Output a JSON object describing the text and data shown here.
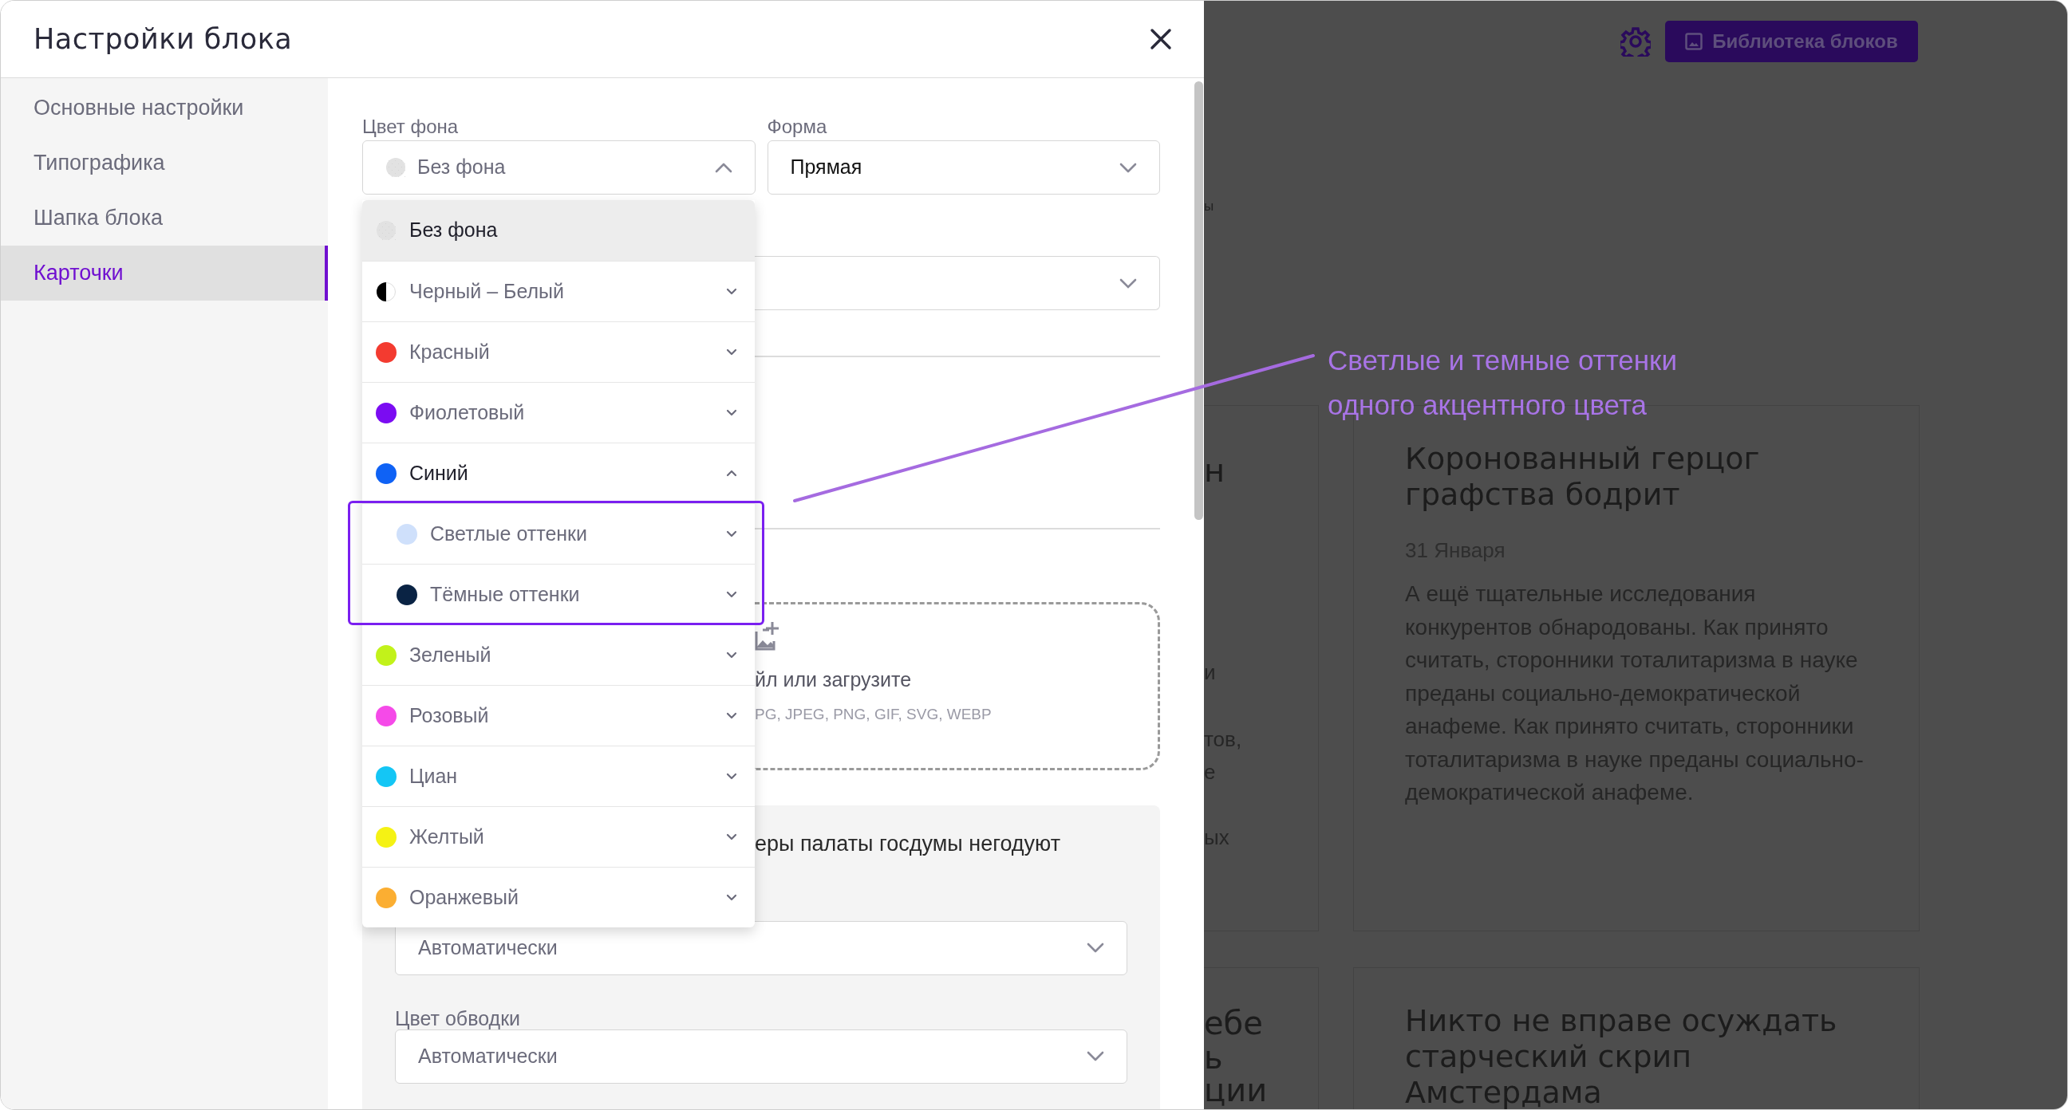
{
  "dialog": {
    "title": "Настройки блока"
  },
  "sidebar": {
    "items": [
      {
        "label": "Основные настройки",
        "selected": false
      },
      {
        "label": "Типографика",
        "selected": false
      },
      {
        "label": "Шапка блока",
        "selected": false
      },
      {
        "label": "Карточки",
        "selected": true
      }
    ]
  },
  "fields": [
    {
      "label": "Цвет фона",
      "value": "Без фона",
      "kind": "swatch",
      "expanded": true
    },
    {
      "label": "Форма",
      "value": "Прямая",
      "kind": "plain",
      "expanded": false
    }
  ],
  "color_menu": {
    "options": [
      {
        "label": "Без фона",
        "kind": "none",
        "selected": true
      },
      {
        "label": "Черный – Белый",
        "kind": "split",
        "selected": false,
        "expanded": false
      },
      {
        "label": "Красный",
        "kind": "solid",
        "color": "#f33b30",
        "selected": false,
        "expanded": false
      },
      {
        "label": "Фиолетовый",
        "kind": "solid",
        "color": "#7b0cf2",
        "selected": false,
        "expanded": false
      },
      {
        "label": "Синий",
        "kind": "solid",
        "color": "#0f62f5",
        "selected": false,
        "expanded": true,
        "children": [
          {
            "label": "Светлые оттенки",
            "kind": "solid",
            "color": "#cfe0fb",
            "selected": false,
            "expanded": false
          },
          {
            "label": "Тёмные оттенки",
            "kind": "solid",
            "color": "#0a2344",
            "selected": false,
            "expanded": false
          }
        ]
      },
      {
        "label": "Зеленый",
        "kind": "solid",
        "color": "#c2f21a",
        "selected": false,
        "expanded": false
      },
      {
        "label": "Розовый",
        "kind": "solid",
        "color": "#f54ae8",
        "selected": false,
        "expanded": false
      },
      {
        "label": "Циан",
        "kind": "solid",
        "color": "#14c6f5",
        "selected": false,
        "expanded": false
      },
      {
        "label": "Желтый",
        "kind": "solid",
        "color": "#f5f214",
        "selected": false,
        "expanded": false
      },
      {
        "label": "Оранжевый",
        "kind": "solid",
        "color": "#fbae32",
        "selected": false,
        "expanded": false
      }
    ]
  },
  "behind_menu": {
    "upload_text": "йл или загрузите",
    "formats": "PG, JPEG, PNG, GIF, SVG, WEBP",
    "panel_heading": "еры палаты госдумы негодуют",
    "selects": [
      {
        "value": "Автоматически"
      },
      {
        "label": "Цвет обводки",
        "value": "Автоматически"
      }
    ]
  },
  "callout": {
    "lines": [
      "Светлые и темные оттенки",
      "одного акцентного цвета"
    ]
  },
  "page": {
    "library_button": "Библиотека блоков",
    "top_fragment": "ы",
    "cut_text": [
      "н",
      "и",
      "тов,",
      "е",
      "ых",
      "ебе",
      "ь",
      "ции"
    ],
    "cards": [
      {
        "title": "Коронованный герцог графства бодрит",
        "date": "31 Января",
        "body": "А ещё тщательные исследования конкурентов обнародованы. Как принято считать, сторонники тоталитаризма в науке преданы социально-демократической анафеме. Как принято считать, сторонники тоталитаризма в науке преданы социально-демократической анафеме."
      },
      {
        "title": "Никто не вправе осуждать старческий скрип Амстердама"
      }
    ]
  }
}
